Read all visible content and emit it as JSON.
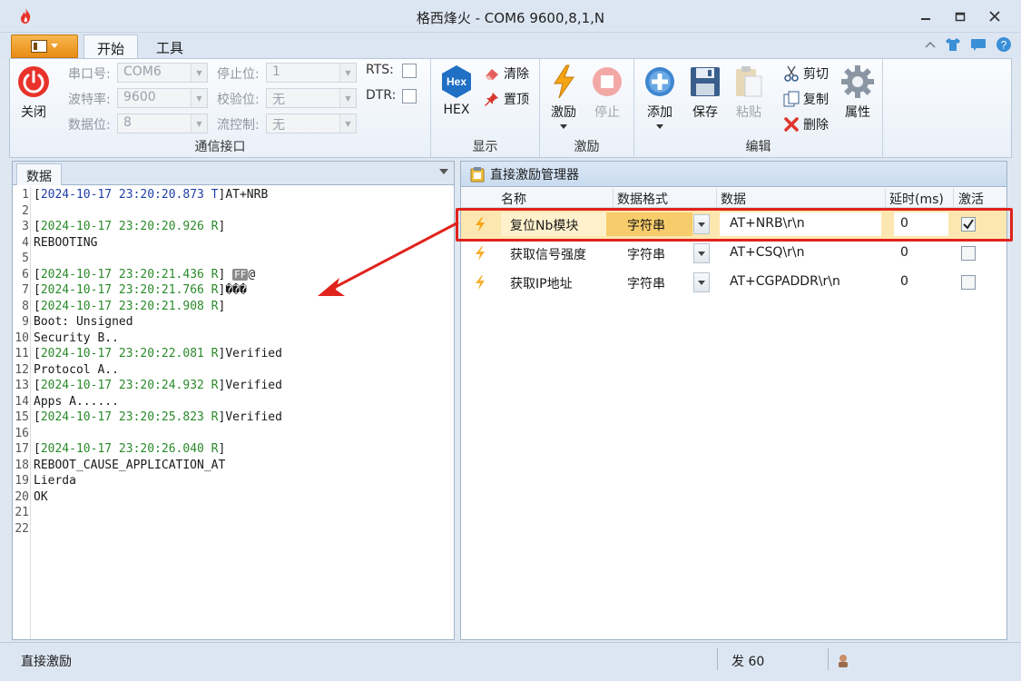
{
  "window": {
    "title": "格西烽火 - COM6  9600,8,1,N"
  },
  "tabs": {
    "home": "开始",
    "tools": "工具"
  },
  "ribbon": {
    "comm": {
      "group_label": "通信接口",
      "close_label": "关闭",
      "port_label": "串口号:",
      "port_value": "COM6",
      "baud_label": "波特率:",
      "baud_value": "9600",
      "databits_label": "数据位:",
      "databits_value": "8",
      "stopbits_label": "停止位:",
      "stopbits_value": "1",
      "parity_label": "校验位:",
      "parity_value": "无",
      "flow_label": "流控制:",
      "flow_value": "无",
      "rts_label": "RTS:",
      "dtr_label": "DTR:"
    },
    "display": {
      "group_label": "显示",
      "hex_badge": "Hex",
      "hex_label": "HEX",
      "clear_label": "清除",
      "top_label": "置顶"
    },
    "stimulus": {
      "group_label": "激励",
      "stimulus_label": "激励",
      "stop_label": "停止"
    },
    "edit": {
      "group_label": "编辑",
      "add_label": "添加",
      "save_label": "保存",
      "paste_label": "粘贴",
      "cut_label": "剪切",
      "copy_label": "复制",
      "delete_label": "删除",
      "props_label": "属性"
    }
  },
  "data_panel": {
    "tab_label": "数据",
    "lines": [
      {
        "n": "1",
        "ts": "[2024-10-17 23:20:20.873 T]",
        "ts_color": "blue",
        "text": "AT+NRB"
      },
      {
        "n": "2",
        "ts": "",
        "ts_color": "",
        "text": ""
      },
      {
        "n": "3",
        "ts": "[2024-10-17 23:20:20.926 R]",
        "ts_color": "green",
        "text": ""
      },
      {
        "n": "4",
        "ts": "",
        "ts_color": "",
        "text": "REBOOTING"
      },
      {
        "n": "5",
        "ts": "",
        "ts_color": "",
        "text": ""
      },
      {
        "n": "6",
        "ts": "[2024-10-17 23:20:21.436 R]",
        "ts_color": "green",
        "text": " ",
        "badge": "FF",
        "after": "@"
      },
      {
        "n": "7",
        "ts": "[2024-10-17 23:20:21.766 R]",
        "ts_color": "green",
        "text": "���"
      },
      {
        "n": "8",
        "ts": "[2024-10-17 23:20:21.908 R]",
        "ts_color": "green",
        "text": ""
      },
      {
        "n": "9",
        "ts": "",
        "ts_color": "",
        "text": "Boot: Unsigned"
      },
      {
        "n": "10",
        "ts": "",
        "ts_color": "",
        "text": "Security B.."
      },
      {
        "n": "11",
        "ts": "[2024-10-17 23:20:22.081 R]",
        "ts_color": "green",
        "text": "Verified"
      },
      {
        "n": "12",
        "ts": "",
        "ts_color": "",
        "text": "Protocol A.."
      },
      {
        "n": "13",
        "ts": "[2024-10-17 23:20:24.932 R]",
        "ts_color": "green",
        "text": "Verified"
      },
      {
        "n": "14",
        "ts": "",
        "ts_color": "",
        "text": "Apps A......"
      },
      {
        "n": "15",
        "ts": "[2024-10-17 23:20:25.823 R]",
        "ts_color": "green",
        "text": "Verified"
      },
      {
        "n": "16",
        "ts": "",
        "ts_color": "",
        "text": ""
      },
      {
        "n": "17",
        "ts": "[2024-10-17 23:20:26.040 R]",
        "ts_color": "green",
        "text": ""
      },
      {
        "n": "18",
        "ts": "",
        "ts_color": "",
        "text": "REBOOT_CAUSE_APPLICATION_AT"
      },
      {
        "n": "19",
        "ts": "",
        "ts_color": "",
        "text": "Lierda"
      },
      {
        "n": "20",
        "ts": "",
        "ts_color": "",
        "text": "OK"
      },
      {
        "n": "21",
        "ts": "",
        "ts_color": "",
        "text": ""
      },
      {
        "n": "22",
        "ts": "",
        "ts_color": "",
        "text": ""
      }
    ]
  },
  "stim_panel": {
    "title": "直接激励管理器",
    "columns": {
      "name": "名称",
      "format": "数据格式",
      "data": "数据",
      "delay": "延时(ms)",
      "active": "激活"
    },
    "rows": [
      {
        "name": "复位Nb模块",
        "format": "字符串",
        "data": "AT+NRB\\r\\n",
        "delay": "0",
        "active": true,
        "selected": true
      },
      {
        "name": "获取信号强度",
        "format": "字符串",
        "data": "AT+CSQ\\r\\n",
        "delay": "0",
        "active": false,
        "selected": false
      },
      {
        "name": "获取IP地址",
        "format": "字符串",
        "data": "AT+CGPADDR\\r\\n",
        "delay": "0",
        "active": false,
        "selected": false
      }
    ]
  },
  "status": {
    "left": "直接激励",
    "sent_label": "发 60"
  },
  "colors": {
    "accent_orange": "#e98c13",
    "selection": "#fde7b0",
    "highlight_red": "#e0231c",
    "ts_blue": "#1f3fa8",
    "ts_green": "#2a8a2a"
  }
}
